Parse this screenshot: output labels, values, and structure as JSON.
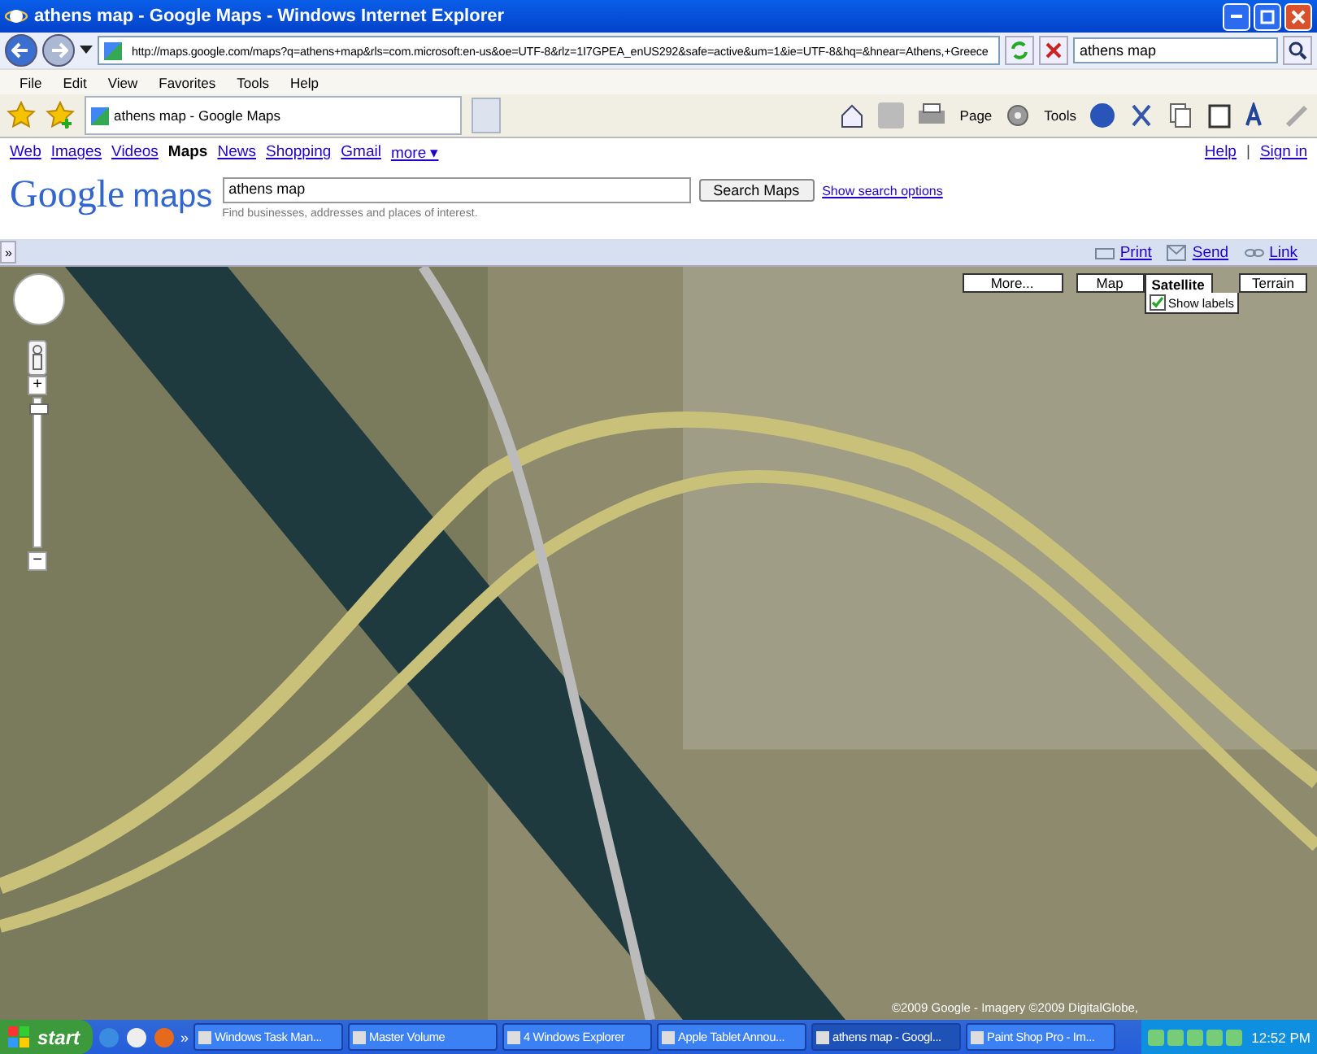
{
  "window": {
    "title": "athens map - Google Maps - Windows Internet Explorer"
  },
  "address_bar": {
    "url": "http://maps.google.com/maps?q=athens+map&rls=com.microsoft:en-us&oe=UTF-8&rlz=1I7GPEA_enUS292&safe=active&um=1&ie=UTF-8&hq=&hnear=Athens,+Greece"
  },
  "search_box": {
    "value": "athens map"
  },
  "menu": [
    "File",
    "Edit",
    "View",
    "Favorites",
    "Tools",
    "Help"
  ],
  "tabs": [
    {
      "label": "athens map - Google Maps",
      "selected": true
    }
  ],
  "command_bar": [
    "Page",
    "Tools"
  ],
  "google_bar": {
    "links": [
      {
        "label": "Web",
        "selected": false
      },
      {
        "label": "Images",
        "selected": false
      },
      {
        "label": "Videos",
        "selected": false
      },
      {
        "label": "Maps",
        "selected": true
      },
      {
        "label": "News",
        "selected": false
      },
      {
        "label": "Shopping",
        "selected": false
      },
      {
        "label": "Gmail",
        "selected": false
      },
      {
        "label": "more ▾",
        "selected": false
      }
    ],
    "right": [
      "Help",
      "|",
      "Sign in"
    ]
  },
  "header": {
    "logo_word": "Google",
    "logo_product": "maps",
    "search_value": "athens map",
    "button": "Search Maps",
    "options_link": "Show search options",
    "hint": "Find businesses, addresses and places of interest."
  },
  "action_bar": {
    "toggle": "»",
    "links": [
      "Print",
      "Send",
      "Link"
    ]
  },
  "map": {
    "zoom": {
      "plus": "+",
      "minus": "−",
      "level": 0.93
    },
    "types": [
      {
        "label": "More...",
        "selected": false
      },
      {
        "label": "Map",
        "selected": false
      },
      {
        "label": "Satellite",
        "selected": true
      },
      {
        "label": "Terrain",
        "selected": false
      }
    ],
    "show_labels": {
      "label": "Show labels",
      "checked": true
    },
    "copyright": "©2009 Google - Imagery ©2009 DigitalGlobe,"
  },
  "taskbar": {
    "start": "start",
    "quick_launch": "»",
    "items": [
      {
        "label": "Windows Task Man...",
        "selected": false
      },
      {
        "label": "Master Volume",
        "selected": false
      },
      {
        "label": "4 Windows Explorer",
        "selected": false
      },
      {
        "label": "Apple Tablet Annou...",
        "selected": false
      },
      {
        "label": "athens map - Googl...",
        "selected": true
      },
      {
        "label": "Paint Shop Pro - Im...",
        "selected": false
      }
    ],
    "clock": "12:52 PM"
  }
}
